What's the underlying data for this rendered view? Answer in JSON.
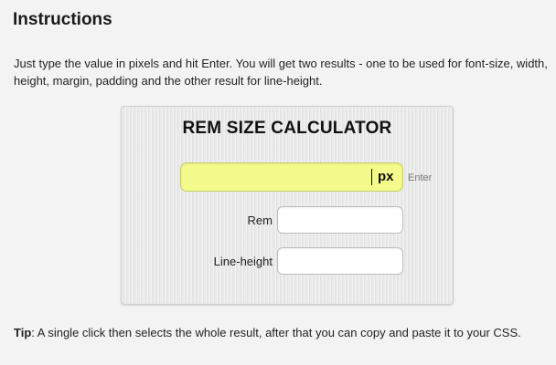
{
  "header": {
    "title": "Instructions"
  },
  "intro": {
    "text": "Just type the value in pixels and hit Enter. You will get two results - one to be used for font-size, width, height, margin, padding and the other result for line-height."
  },
  "calculator": {
    "title": "REM SIZE CALCULATOR",
    "px_input": {
      "value": "",
      "unit_label": "px",
      "hint": "Enter",
      "background_color": "#f4fa8c"
    },
    "rem_row": {
      "label": "Rem",
      "value": ""
    },
    "line_height_row": {
      "label": "Line-height",
      "value": ""
    }
  },
  "tip": {
    "label": "Tip",
    "text": ": A single click then selects the whole result, after that you can copy and paste it to your CSS."
  }
}
